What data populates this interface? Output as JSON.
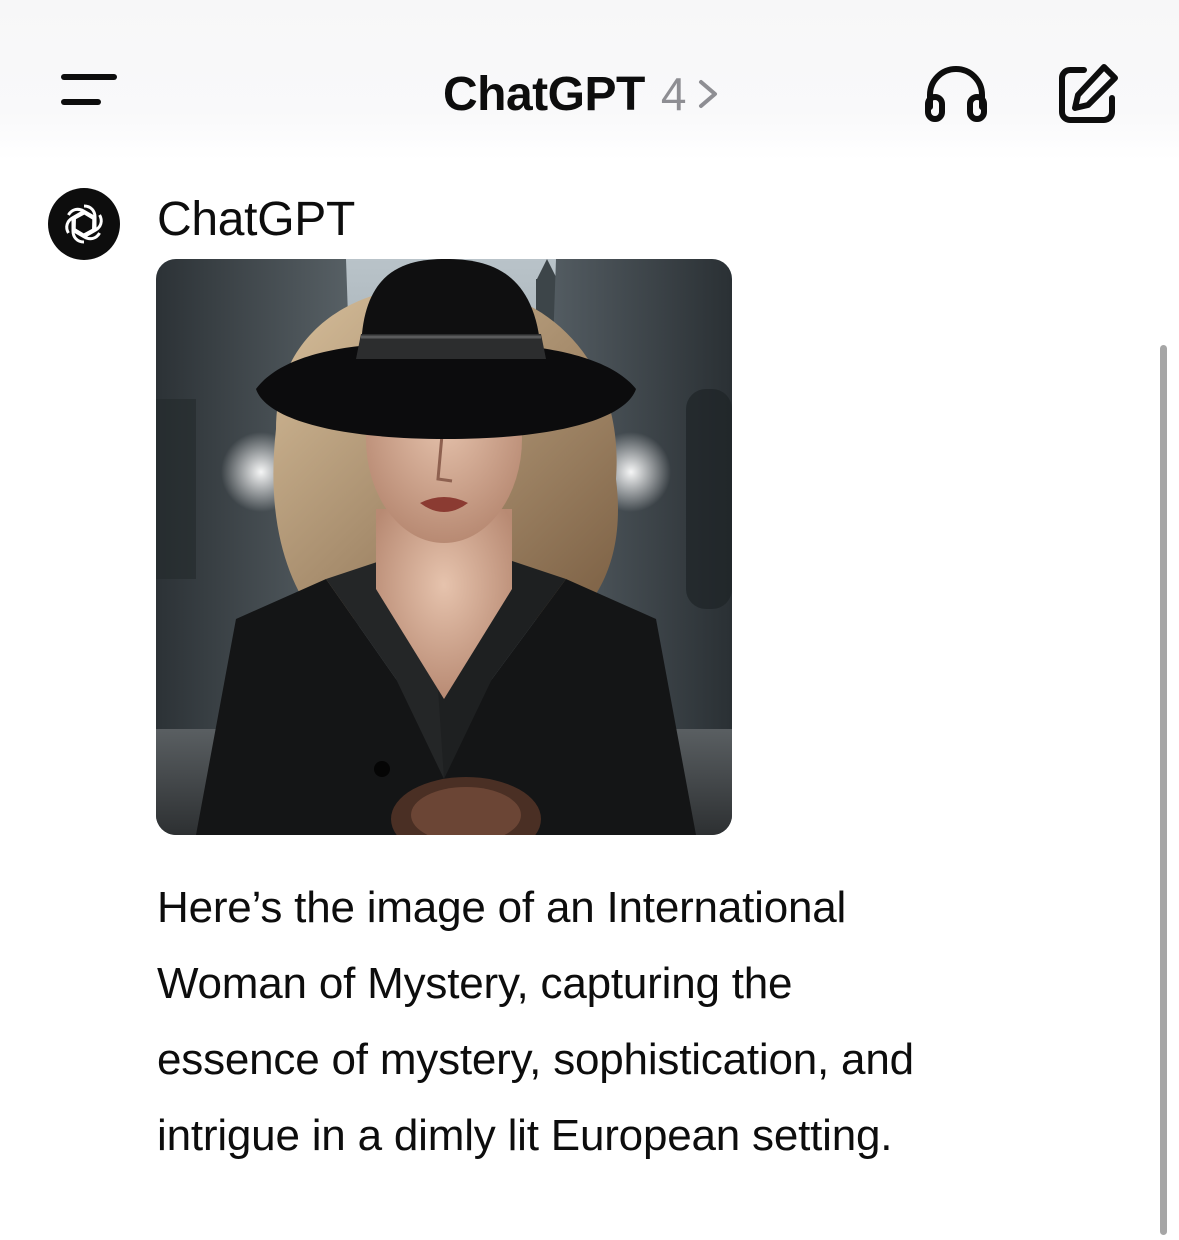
{
  "header": {
    "title": "ChatGPT",
    "version": "4",
    "menu_icon": "hamburger-menu-icon",
    "version_icon": "chevron-right-icon",
    "voice_icon": "headphones-icon",
    "new_chat_icon": "compose-edit-icon"
  },
  "message": {
    "sender": "ChatGPT",
    "avatar_icon": "openai-logo-icon",
    "image_subject": "generated-image",
    "text_lines": [
      "Here’s the image of an International",
      "Woman of Mystery, capturing the",
      "essence of mystery, sophistication, and",
      "intrigue in a dimly lit European setting."
    ]
  },
  "colors": {
    "text": "#0d0d0d",
    "muted": "#8e8e93",
    "header_bg": "#f7f7f8",
    "scrollbar": "#a6a6a6"
  }
}
